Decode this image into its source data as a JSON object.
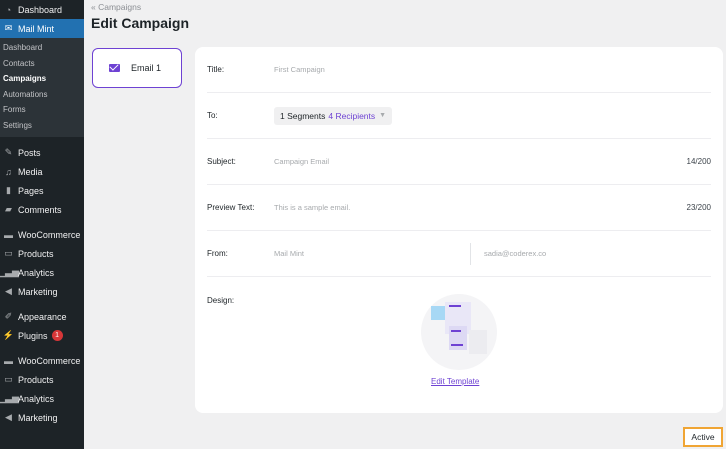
{
  "sidebar": {
    "top": [
      {
        "label": "Dashboard",
        "icon": "gauge-icon"
      },
      {
        "label": "Mail Mint",
        "icon": "mail-icon",
        "active": true
      }
    ],
    "submenu": [
      {
        "label": "Dashboard"
      },
      {
        "label": "Contacts"
      },
      {
        "label": "Campaigns",
        "current": true
      },
      {
        "label": "Automations"
      },
      {
        "label": "Forms"
      },
      {
        "label": "Settings"
      }
    ],
    "rest": [
      {
        "label": "Posts",
        "icon": "pin-icon"
      },
      {
        "label": "Media",
        "icon": "media-icon"
      },
      {
        "label": "Pages",
        "icon": "page-icon"
      },
      {
        "label": "Comments",
        "icon": "comment-icon"
      },
      {
        "label": "WooCommerce",
        "icon": "woo-icon"
      },
      {
        "label": "Products",
        "icon": "box-icon"
      },
      {
        "label": "Analytics",
        "icon": "bars-icon"
      },
      {
        "label": "Marketing",
        "icon": "megaphone-icon"
      },
      {
        "label": "Appearance",
        "icon": "brush-icon"
      },
      {
        "label": "Plugins",
        "icon": "plug-icon",
        "badge": "1"
      },
      {
        "label": "WooCommerce",
        "icon": "woo-icon"
      },
      {
        "label": "Products",
        "icon": "box-icon"
      },
      {
        "label": "Analytics",
        "icon": "bars-icon"
      },
      {
        "label": "Marketing",
        "icon": "megaphone-icon"
      }
    ]
  },
  "breadcrumb": "« Campaigns",
  "page_title": "Edit Campaign",
  "email_tab": {
    "label": "Email 1"
  },
  "form": {
    "title_label": "Title:",
    "title_value": "First Campaign",
    "to_label": "To:",
    "segments": "1 Segments",
    "recipients": "4 Recipients",
    "subject_label": "Subject:",
    "subject_value": "Campaign Email",
    "subject_count": "14/200",
    "preview_label": "Preview Text:",
    "preview_value": "This is a sample email.",
    "preview_count": "23/200",
    "from_label": "From:",
    "from_name": "Mail Mint",
    "from_email": "sadia@coderex.co",
    "design_label": "Design:",
    "edit_template": "Edit Template"
  },
  "status_button": "Active",
  "colors": {
    "accent": "#6e42d3",
    "sidebar": "#1d2327",
    "active_menu": "#2271b1",
    "highlight": "#f0a534"
  }
}
